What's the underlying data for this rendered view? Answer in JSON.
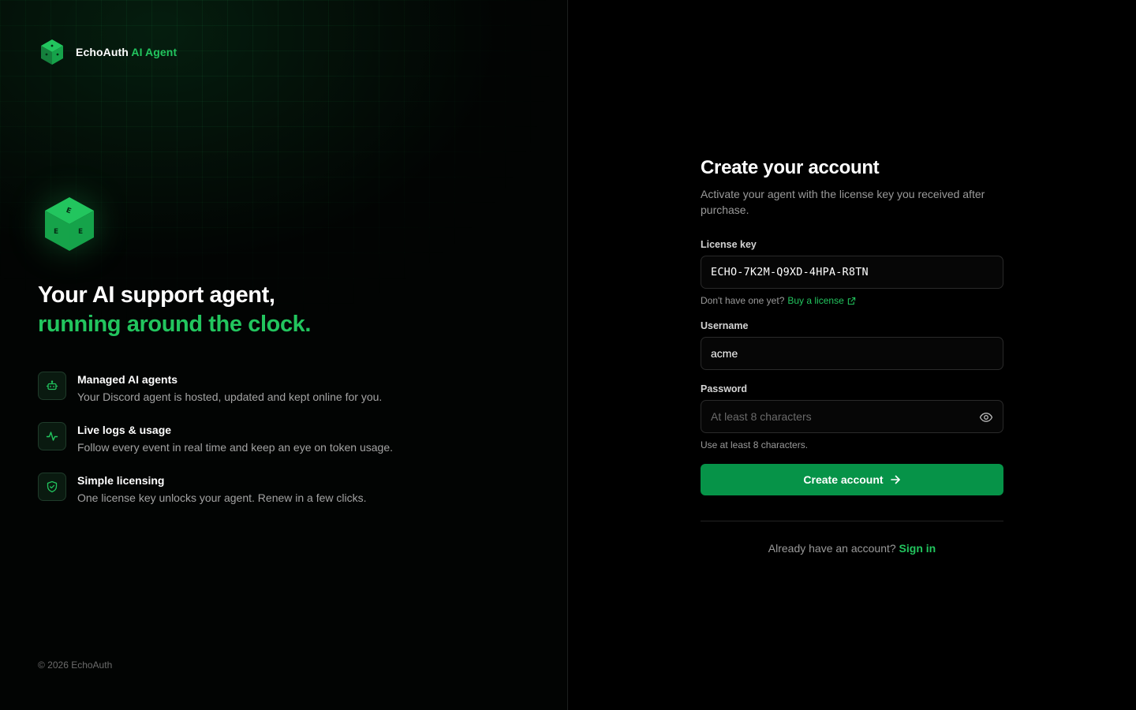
{
  "brand": {
    "name": "EchoAuth",
    "accent": "AI Agent",
    "accent_color": "#22c55e"
  },
  "hero": {
    "line1": "Your AI support agent,",
    "line2": "running around the clock."
  },
  "features": [
    {
      "icon": "robot-icon",
      "title": "Managed AI agents",
      "desc": "Your Discord agent is hosted, updated and kept online for you."
    },
    {
      "icon": "activity-icon",
      "title": "Live logs & usage",
      "desc": "Follow every event in real time and keep an eye on token usage."
    },
    {
      "icon": "shield-check-icon",
      "title": "Simple licensing",
      "desc": "One license key unlocks your agent. Renew in a few clicks."
    }
  ],
  "footer": {
    "copyright": "© 2026 EchoAuth"
  },
  "form": {
    "title": "Create your account",
    "subtitle": "Activate your agent with the license key you received after purchase.",
    "license": {
      "label": "License key",
      "value": "ECHO-7K2M-Q9XD-4HPA-R8TN",
      "hint_text": "Don't have one yet?",
      "hint_link": "Buy a license"
    },
    "username": {
      "label": "Username",
      "value": "acme"
    },
    "password": {
      "label": "Password",
      "placeholder": "At least 8 characters",
      "hint": "Use at least 8 characters."
    },
    "submit_label": "Create account",
    "signin_text": "Already have an account?",
    "signin_link": "Sign in"
  },
  "colors": {
    "primary_button": "#069348",
    "accent": "#22c55e",
    "background": "#000000"
  }
}
